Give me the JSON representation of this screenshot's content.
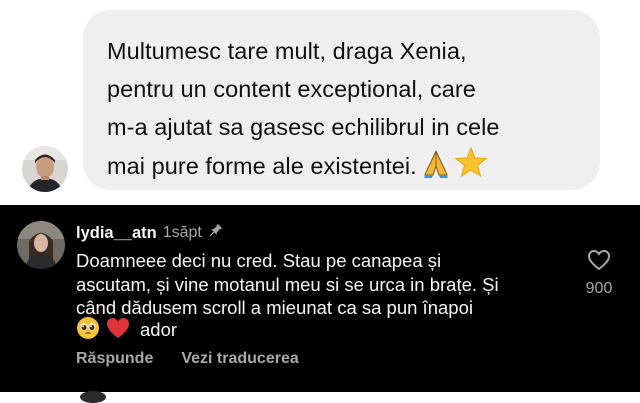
{
  "message": {
    "lines": [
      "Multumesc tare mult, draga Xenia,",
      "pentru un content exceptional, care",
      "m-a ajutat sa gasesc echilibrul in cele",
      "mai pure forme ale existentei."
    ],
    "emojis": [
      "folded-hands-emoji",
      "star-emoji"
    ]
  },
  "comment": {
    "username": "lydia__atn",
    "time": "1săpt",
    "body_lines": [
      "Doamneee deci nu cred. Stau pe canapea și",
      "ascutam, și vine motanul meu si se urca in brațe. Și",
      "când dădusem scroll a mieunat ca sa pun înapoi"
    ],
    "last_word": "ador",
    "emojis": [
      "pleading-face-emoji",
      "red-heart-emoji"
    ],
    "like_count": "900",
    "reply_label": "Răspunde",
    "translate_label": "Vezi traducerea"
  },
  "colors": {
    "bubble_bg": "#efefef",
    "dark_bg": "#000000",
    "primary_text_dark": "#f5f5f5",
    "secondary_text_dark": "#a8a8a8",
    "heart_red": "#e0323a",
    "star_yellow": "#f9c22e"
  }
}
